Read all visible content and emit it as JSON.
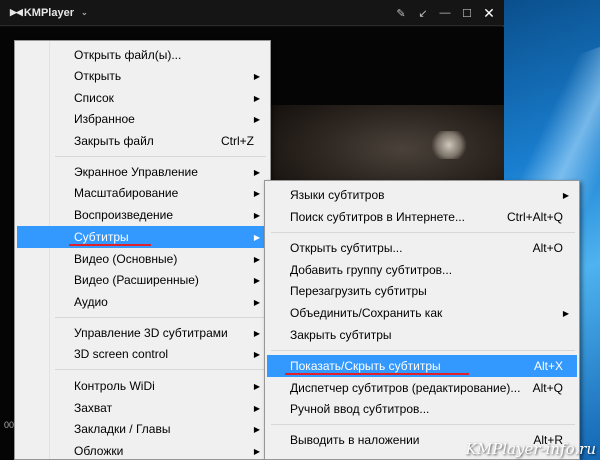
{
  "player": {
    "title": "KMPlayer",
    "logo_mark": "▶◀",
    "dropdown_glyph": "⌄",
    "toolbar_icons": [
      "pin-icon",
      "shrink-icon",
      "minimize-icon",
      "maximize-icon",
      "close-icon"
    ],
    "toolbar_glyphs": [
      "✎",
      "↙",
      "—",
      "☐",
      "✕"
    ],
    "timecode": "00"
  },
  "main_menu": {
    "items": [
      {
        "label": "Открыть файл(ы)...",
        "shortcut": "",
        "submenu": false
      },
      {
        "label": "Открыть",
        "shortcut": "",
        "submenu": true
      },
      {
        "label": "Список",
        "shortcut": "",
        "submenu": true
      },
      {
        "label": "Избранное",
        "shortcut": "",
        "submenu": true
      },
      {
        "label": "Закрыть файл",
        "shortcut": "Ctrl+Z",
        "submenu": false
      },
      {
        "label": "Экранное Управление",
        "shortcut": "",
        "submenu": true
      },
      {
        "label": "Масштабирование",
        "shortcut": "",
        "submenu": true
      },
      {
        "label": "Воспроизведение",
        "shortcut": "",
        "submenu": true
      },
      {
        "label": "Субтитры",
        "shortcut": "",
        "submenu": true,
        "highlighted": true
      },
      {
        "label": "Видео (Основные)",
        "shortcut": "",
        "submenu": true
      },
      {
        "label": "Видео (Расширенные)",
        "shortcut": "",
        "submenu": true
      },
      {
        "label": "Аудио",
        "shortcut": "",
        "submenu": true
      },
      {
        "label": "Управление 3D субтитрами",
        "shortcut": "",
        "submenu": true
      },
      {
        "label": "3D screen control",
        "shortcut": "",
        "submenu": true
      },
      {
        "label": "Контроль WiDi",
        "shortcut": "",
        "submenu": true
      },
      {
        "label": "Захват",
        "shortcut": "",
        "submenu": true
      },
      {
        "label": "Закладки / Главы",
        "shortcut": "",
        "submenu": true
      },
      {
        "label": "Обложки",
        "shortcut": "",
        "submenu": true
      }
    ]
  },
  "subtitles_menu": {
    "items": [
      {
        "label": "Языки субтитров",
        "shortcut": "",
        "submenu": true
      },
      {
        "label": "Поиск субтитров в Интернете...",
        "shortcut": "Ctrl+Alt+Q",
        "submenu": false
      },
      {
        "label": "Открыть субтитры...",
        "shortcut": "Alt+O",
        "submenu": false
      },
      {
        "label": "Добавить группу субтитров...",
        "shortcut": "",
        "submenu": false
      },
      {
        "label": "Перезагрузить субтитры",
        "shortcut": "",
        "submenu": false
      },
      {
        "label": "Объединить/Сохранить как",
        "shortcut": "",
        "submenu": true
      },
      {
        "label": "Закрыть субтитры",
        "shortcut": "",
        "submenu": false
      },
      {
        "label": "Показать/Скрыть субтитры",
        "shortcut": "Alt+X",
        "submenu": false,
        "highlighted": true
      },
      {
        "label": "Диспетчер субтитров (редактирование)...",
        "shortcut": "Alt+Q",
        "submenu": false
      },
      {
        "label": "Ручной ввод субтитров...",
        "shortcut": "",
        "submenu": false
      },
      {
        "label": "Выводить в наложении",
        "shortcut": "Alt+R",
        "submenu": false
      }
    ]
  },
  "submenu_arrow": "▶",
  "watermark": "KMPlayer-info.ru",
  "colors": {
    "highlight": "#3399ff",
    "annotation_underline": "#e0202b",
    "menu_bg": "#f0f0f0"
  }
}
